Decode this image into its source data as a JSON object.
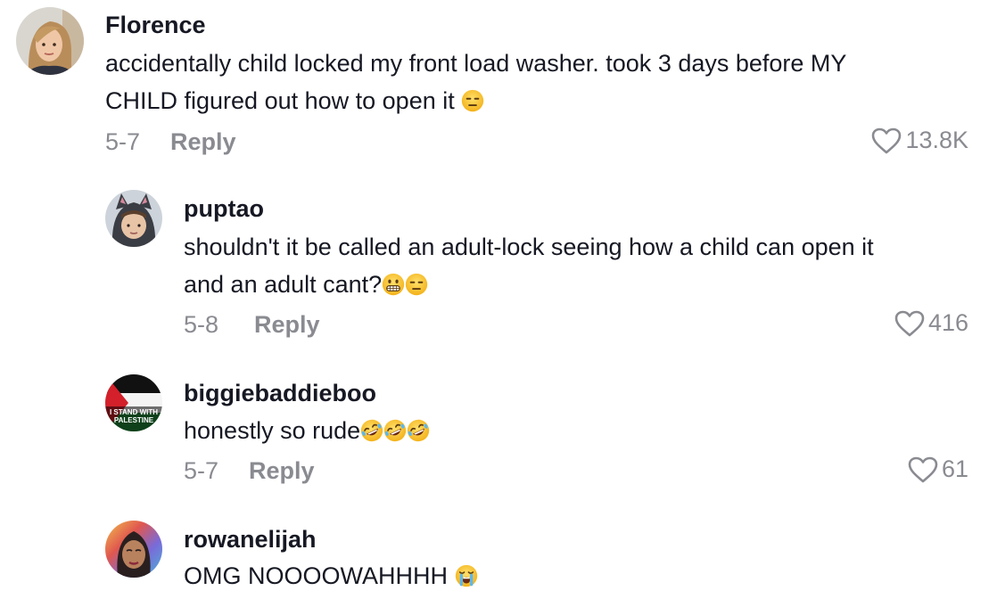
{
  "comments": [
    {
      "username": "Florence",
      "text_line1": "accidentally child locked my front load washer. took 3 days before MY",
      "text_line2": "CHILD figured out how to open it",
      "emojis": [
        "expressionless-face"
      ],
      "date": "5-7",
      "reply_label": "Reply",
      "likes": "13.8K"
    },
    {
      "username": "puptao",
      "text_line1": "shouldn't it be called an adult-lock seeing how a child can open it",
      "text_line2": "and an adult cant?",
      "emojis": [
        "grimacing-face",
        "expressionless-face"
      ],
      "date": "5-8",
      "reply_label": "Reply",
      "likes": "416"
    },
    {
      "username": "biggiebaddieboo",
      "text_line1": "honestly so rude",
      "emojis": [
        "rolling-on-floor-laughing",
        "rolling-on-floor-laughing",
        "rolling-on-floor-laughing"
      ],
      "avatar_text_line1": "I STAND WITH",
      "avatar_text_line2": "PALESTINE",
      "date": "5-7",
      "reply_label": "Reply",
      "likes": "61"
    },
    {
      "username": "rowanelijah",
      "text_line1": "OMG NOOOOWAHHHH",
      "emojis": [
        "loudly-crying-face"
      ],
      "date": "",
      "reply_label": "",
      "likes": ""
    }
  ],
  "colors": {
    "text": "#161823",
    "muted": "#8a8b91",
    "emoji_yellow": "#f7c02f"
  },
  "icons": {
    "like": "heart-outline-icon"
  }
}
